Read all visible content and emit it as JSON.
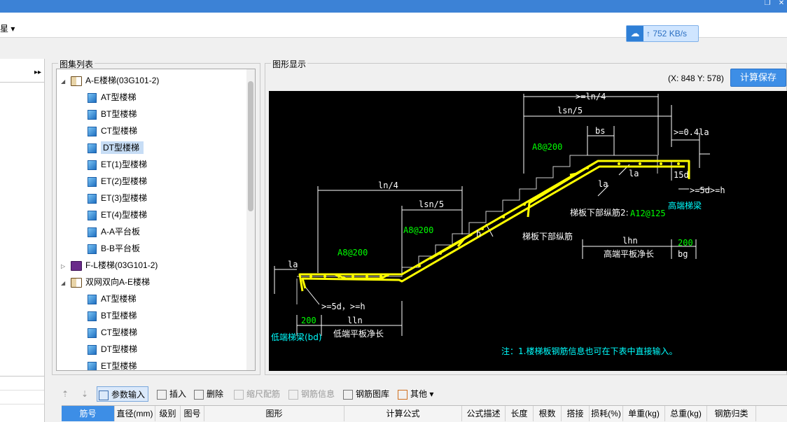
{
  "window": {
    "restore_glyph": "❐",
    "close_glyph": "✕"
  },
  "menu": {
    "fragment": "星 ▾"
  },
  "network": {
    "speed": "↑ 752 KB/s"
  },
  "left_panel": {
    "collapse_glyph": "▸▸"
  },
  "atlas": {
    "title": "图集列表",
    "items": [
      {
        "label": "A-E楼梯(03G101-2)",
        "kind": "book-open",
        "expanded": true,
        "level": 0
      },
      {
        "label": "AT型楼梯",
        "kind": "page",
        "level": 1
      },
      {
        "label": "BT型楼梯",
        "kind": "page",
        "level": 1
      },
      {
        "label": "CT型楼梯",
        "kind": "page",
        "level": 1
      },
      {
        "label": "DT型楼梯",
        "kind": "page",
        "level": 1,
        "selected": true
      },
      {
        "label": "ET(1)型楼梯",
        "kind": "page",
        "level": 1
      },
      {
        "label": "ET(2)型楼梯",
        "kind": "page",
        "level": 1
      },
      {
        "label": "ET(3)型楼梯",
        "kind": "page",
        "level": 1
      },
      {
        "label": "ET(4)型楼梯",
        "kind": "page",
        "level": 1
      },
      {
        "label": "A-A平台板",
        "kind": "page",
        "level": 1
      },
      {
        "label": "B-B平台板",
        "kind": "page",
        "level": 1
      },
      {
        "label": "F-L楼梯(03G101-2)",
        "kind": "book-closed",
        "expanded": false,
        "level": 0
      },
      {
        "label": "双网双向A-E楼梯",
        "kind": "book-open",
        "expanded": true,
        "level": 0
      },
      {
        "label": "AT型楼梯",
        "kind": "page",
        "level": 1
      },
      {
        "label": "BT型楼梯",
        "kind": "page",
        "level": 1
      },
      {
        "label": "CT型楼梯",
        "kind": "page",
        "level": 1
      },
      {
        "label": "DT型楼梯",
        "kind": "page",
        "level": 1
      },
      {
        "label": "ET型楼梯",
        "kind": "page",
        "level": 1
      }
    ]
  },
  "figure": {
    "title": "图形显示",
    "coordinates": "(X: 848 Y: 578)",
    "calc_save_label": "计算保存",
    "colors": {
      "rebar": "#ffff00",
      "dimension": "#ffffff",
      "rebar_label": "#00ff00",
      "beam_label": "#00ffff"
    },
    "labels": {
      "ge_ln4_top": ">=ln/4",
      "lsn5_top": "lsn/5",
      "bs": "bs",
      "ge_04la": ">=0.4la",
      "a8_200_top": "A8@200",
      "d15": "15d",
      "la_right": "la",
      "la_right2": "la",
      "ge5d_h_right": ">=5d>=h",
      "high_beam": "高端梯梁",
      "ln4_mid": "ln/4",
      "lsn5_mid": "lsn/5",
      "bottom_rebar2": "梯板下部纵筋2:",
      "a12_125": "A12@125",
      "a8_200_mid": "A8@200",
      "h_mark": "h",
      "bottom_rebar": "梯板下部纵筋",
      "a8_200_low": "A8@200",
      "lhn": "lhn",
      "w200_right": "200",
      "high_platform": "高端平板净长",
      "bg": "bg",
      "la_left": "la",
      "ge5d_h_left": ">=5d，>=h",
      "w200_left": "200",
      "lln": "lln",
      "low_beam": "低端梯梁(bd)",
      "low_platform": "低端平板净长",
      "note": "注：1.楼梯板钢筋信息也可在下表中直接输入。"
    }
  },
  "toolbar": {
    "up_glyph": "⇡",
    "down_glyph": "⇣",
    "param_input": "参数输入",
    "insert": "插入",
    "delete": "删除",
    "scale_rebar": "缩尺配筋",
    "rebar_info": "钢筋信息",
    "rebar_library": "钢筋图库",
    "other": "其他"
  },
  "grid": {
    "columns": [
      "筋号",
      "直径(mm)",
      "级别",
      "图号",
      "图形",
      "计算公式",
      "公式描述",
      "长度",
      "根数",
      "搭接",
      "损耗(%)",
      "单重(kg)",
      "总重(kg)",
      "钢筋归类"
    ]
  }
}
